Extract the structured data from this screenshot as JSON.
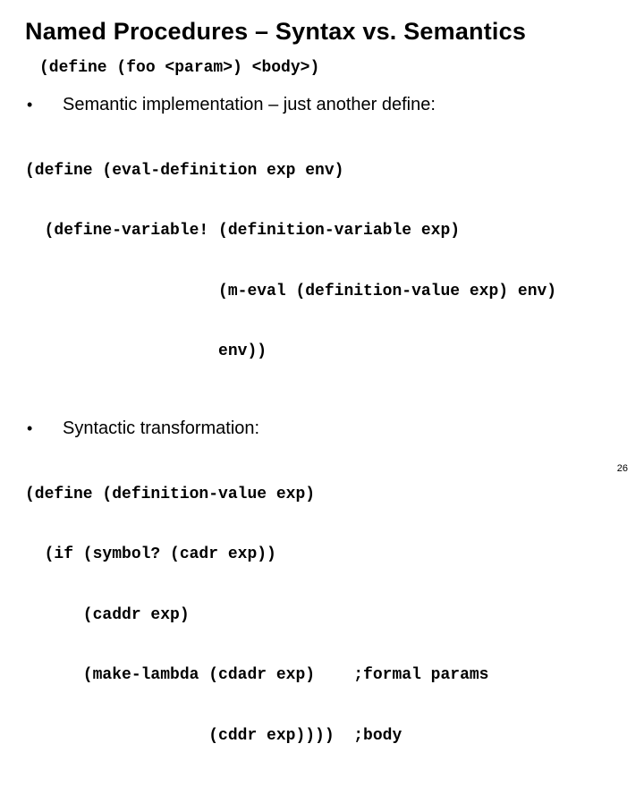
{
  "title": "Named Procedures – Syntax vs. Semantics",
  "syntax_line": "(define (foo <param>) <body>)",
  "bullet1": "Semantic implementation – just another define:",
  "code1_l1": "(define (eval-definition exp env)",
  "code1_l2": "  (define-variable! (definition-variable exp)",
  "code1_l3": "                    (m-eval (definition-value exp) env)",
  "code1_l4": "                    env))",
  "bullet2": "Syntactic transformation:",
  "code2_l1": "(define (definition-value exp)",
  "code2_l2": "  (if (symbol? (cadr exp))",
  "code2_l3": "      (caddr exp)",
  "code2_l4": "      (make-lambda (cdadr exp)    ;formal params",
  "code2_l5": "                   (cddr exp))))  ;body",
  "page_number": "26"
}
